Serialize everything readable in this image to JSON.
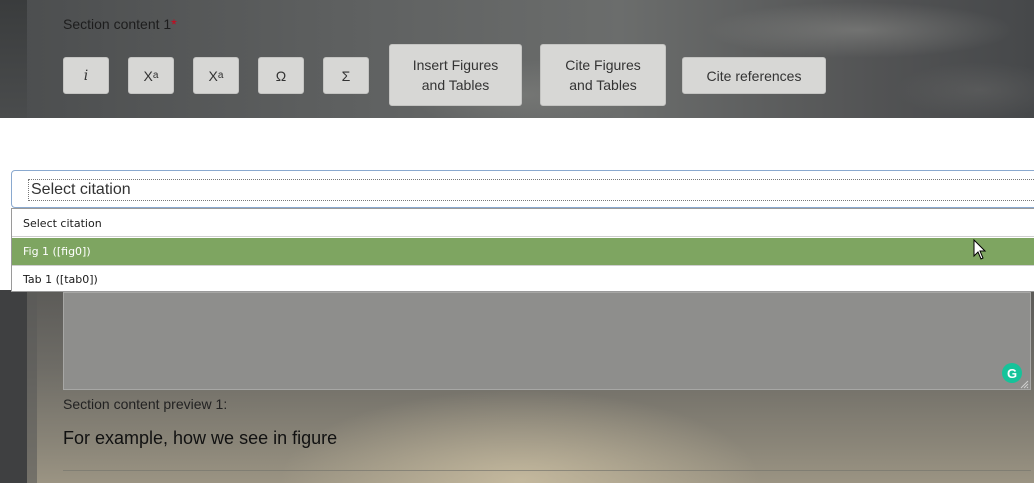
{
  "editor": {
    "section_label": "Section content 1",
    "required_marker": "*",
    "toolbar": {
      "italic_label": "i",
      "superscript_base": "X",
      "superscript_mark": "a",
      "subscript_base": "X",
      "subscript_mark": "a",
      "omega_label": "Ω",
      "sigma_label": "Σ",
      "insert_figures_line1": "Insert Figures",
      "insert_figures_line2": "and Tables",
      "cite_figures_line1": "Cite Figures",
      "cite_figures_line2": "and Tables",
      "cite_references_label": "Cite references"
    }
  },
  "citation_select": {
    "selected_value": "Select citation",
    "options": [
      {
        "label": "Select citation",
        "highlighted": false
      },
      {
        "label": "Fig 1 ([fig0])",
        "highlighted": true
      },
      {
        "label": "Tab 1 ([tab0])",
        "highlighted": false
      }
    ],
    "highlight_color": "#7ea561"
  },
  "preview": {
    "label": "Section content preview 1:",
    "text": "For example, how we see in figure"
  },
  "icons": {
    "grammarly": "grammarly-icon",
    "cursor": "mouse-pointer-icon",
    "resize": "resize-handle-icon"
  }
}
